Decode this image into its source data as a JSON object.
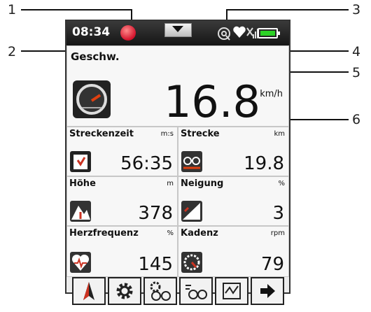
{
  "status": {
    "time": "08:34"
  },
  "callouts": [
    "1",
    "2",
    "3",
    "4",
    "5",
    "6"
  ],
  "speed": {
    "label": "Geschw.",
    "unit": "km/h",
    "value": "16.8"
  },
  "tiles": [
    {
      "label": "Streckenzeit",
      "unit": "m:s",
      "value": "56:35",
      "icon": "stopwatch-icon"
    },
    {
      "label": "Strecke",
      "unit": "km",
      "value": "19.8",
      "icon": "bike-distance-icon"
    },
    {
      "label": "Höhe",
      "unit": "m",
      "value": "378",
      "icon": "mountain-icon"
    },
    {
      "label": "Neigung",
      "unit": "%",
      "value": "3",
      "icon": "incline-icon"
    },
    {
      "label": "Herzfrequenz",
      "unit": "%",
      "value": "145",
      "icon": "heart-rate-icon"
    },
    {
      "label": "Kadenz",
      "unit": "rpm",
      "value": "79",
      "icon": "cadence-icon"
    }
  ],
  "toolbar": [
    "compass-icon",
    "gear-icon",
    "bike-wheels-icon",
    "bike-speed-icon",
    "map-icon",
    "arrow-right-icon"
  ],
  "colors": {
    "statusbar": "#1e1e1e",
    "record": "#d3122b",
    "battery": "#2dd226",
    "icon_red": "#cc3322"
  }
}
